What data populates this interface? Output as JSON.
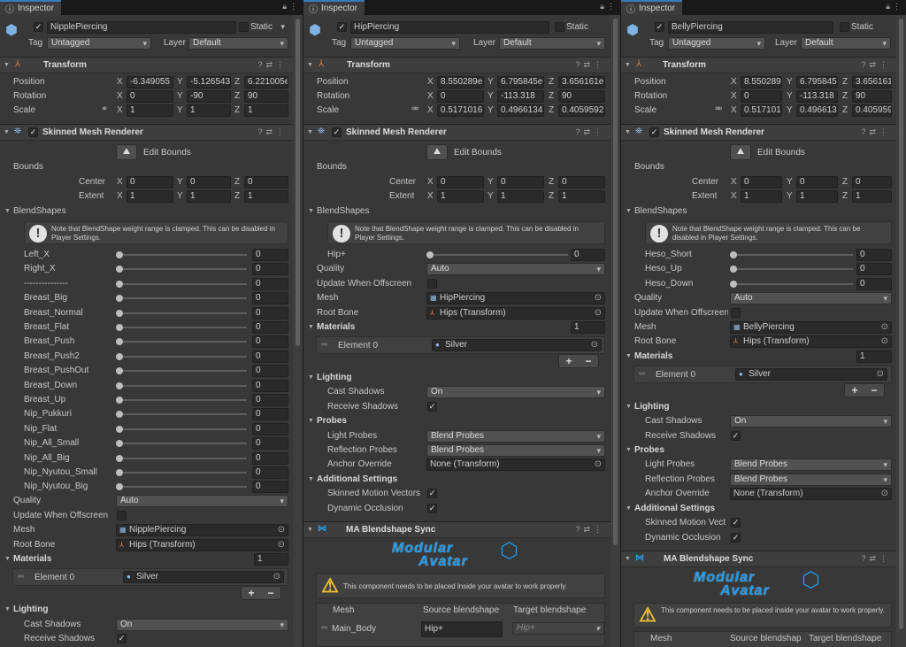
{
  "tab": {
    "label": "Inspector"
  },
  "common": {
    "static": "Static",
    "tag": "Tag",
    "layer": "Layer",
    "tag_value": "Untagged",
    "layer_value": "Default",
    "transform": "Transform",
    "position": "Position",
    "rotation": "Rotation",
    "scale": "Scale",
    "x": "X",
    "y": "Y",
    "z": "Z",
    "smr": "Skinned Mesh Renderer",
    "edit_bounds": "Edit Bounds",
    "bounds": "Bounds",
    "center": "Center",
    "extent": "Extent",
    "blendshapes": "BlendShapes",
    "note": "Note that BlendShape weight range is clamped. This can be disabled in Player Settings.",
    "quality": "Quality",
    "quality_value": "Auto",
    "update_offscreen": "Update When Offscreen",
    "mesh": "Mesh",
    "root_bone": "Root Bone",
    "root_bone_value": "Hips (Transform)",
    "materials": "Materials",
    "materials_count": "1",
    "element0": "Element 0",
    "silver": "Silver",
    "plus": "+",
    "minus": "−",
    "lighting": "Lighting",
    "cast_shadows": "Cast Shadows",
    "cast_value": "On",
    "receive_shadows": "Receive Shadows",
    "probes": "Probes",
    "light_probes": "Light Probes",
    "light_probes_value": "Blend Probes",
    "reflection_probes": "Reflection Probes",
    "reflection_value": "Blend Probes",
    "anchor_override": "Anchor Override",
    "anchor_value": "None (Transform)",
    "additional": "Additional Settings",
    "motion_vectors": "Skinned Motion Vectors",
    "motion_vectors_short": "Skinned Motion Vect",
    "dynamic_occlusion": "Dynamic Occlusion",
    "ma_title": "MA Blendshape Sync",
    "logo_line1": "Modular",
    "logo_line2": "Avatar",
    "warn": "This component needs to be placed inside your avatar to work properly.",
    "col_mesh": "Mesh",
    "col_source": "Source blendshape",
    "col_source_short": "Source blendshap",
    "col_target": "Target blendshape",
    "row_mesh": "Main_Body",
    "row_source": "Hip+",
    "row_target": "Hip+"
  },
  "panels": [
    {
      "name": "NipplePiercing",
      "position": [
        "-6.349055",
        "-5.126543",
        "6.221005e"
      ],
      "rotation": [
        "0",
        "-90",
        "90"
      ],
      "scale": [
        "1",
        "1",
        "1"
      ],
      "center": [
        "0",
        "0",
        "0"
      ],
      "extent": [
        "1",
        "1",
        "1"
      ],
      "mesh_value": "NipplePiercing",
      "blendshapes": [
        {
          "name": "Left_X",
          "value": "0"
        },
        {
          "name": "Right_X",
          "value": "0"
        },
        {
          "name": "---------------",
          "value": "0"
        },
        {
          "name": "Breast_Big",
          "value": "0"
        },
        {
          "name": "Breast_Normal",
          "value": "0"
        },
        {
          "name": "Breast_Flat",
          "value": "0"
        },
        {
          "name": "Breast_Push",
          "value": "0"
        },
        {
          "name": "Breast_Push2",
          "value": "0"
        },
        {
          "name": "Breast_PushOut",
          "value": "0"
        },
        {
          "name": "Breast_Down",
          "value": "0"
        },
        {
          "name": "Breast_Up",
          "value": "0"
        },
        {
          "name": "Nip_Pukkuri",
          "value": "0"
        },
        {
          "name": "Nip_Flat",
          "value": "0"
        },
        {
          "name": "Nip_All_Small",
          "value": "0"
        },
        {
          "name": "Nip_All_Big",
          "value": "0"
        },
        {
          "name": "Nip_Nyutou_Small",
          "value": "0"
        },
        {
          "name": "Nip_Nyutou_Big",
          "value": "0"
        }
      ]
    },
    {
      "name": "HipPiercing",
      "position": [
        "8.550289e",
        "6.795845e",
        "3.656161e"
      ],
      "rotation": [
        "0",
        "-113.318",
        "90"
      ],
      "scale": [
        "0.5171016",
        "0.4966134",
        "0.4059592"
      ],
      "center": [
        "0",
        "0",
        "0"
      ],
      "extent": [
        "1",
        "1",
        "1"
      ],
      "mesh_value": "HipPiercing",
      "blendshapes": [
        {
          "name": "Hip+",
          "value": "0"
        }
      ]
    },
    {
      "name": "BellyPiercing",
      "position": [
        "8.550289",
        "6.795845",
        "3.656161"
      ],
      "rotation": [
        "0",
        "-113.318",
        "90"
      ],
      "scale": [
        "0.517101",
        "0.496613",
        "0.405959"
      ],
      "center": [
        "0",
        "0",
        "0"
      ],
      "extent": [
        "1",
        "1",
        "1"
      ],
      "mesh_value": "BellyPiercing",
      "blendshapes": [
        {
          "name": "Heso_Short",
          "value": "0"
        },
        {
          "name": "Heso_Up",
          "value": "0"
        },
        {
          "name": "Heso_Down",
          "value": "0"
        }
      ]
    }
  ]
}
